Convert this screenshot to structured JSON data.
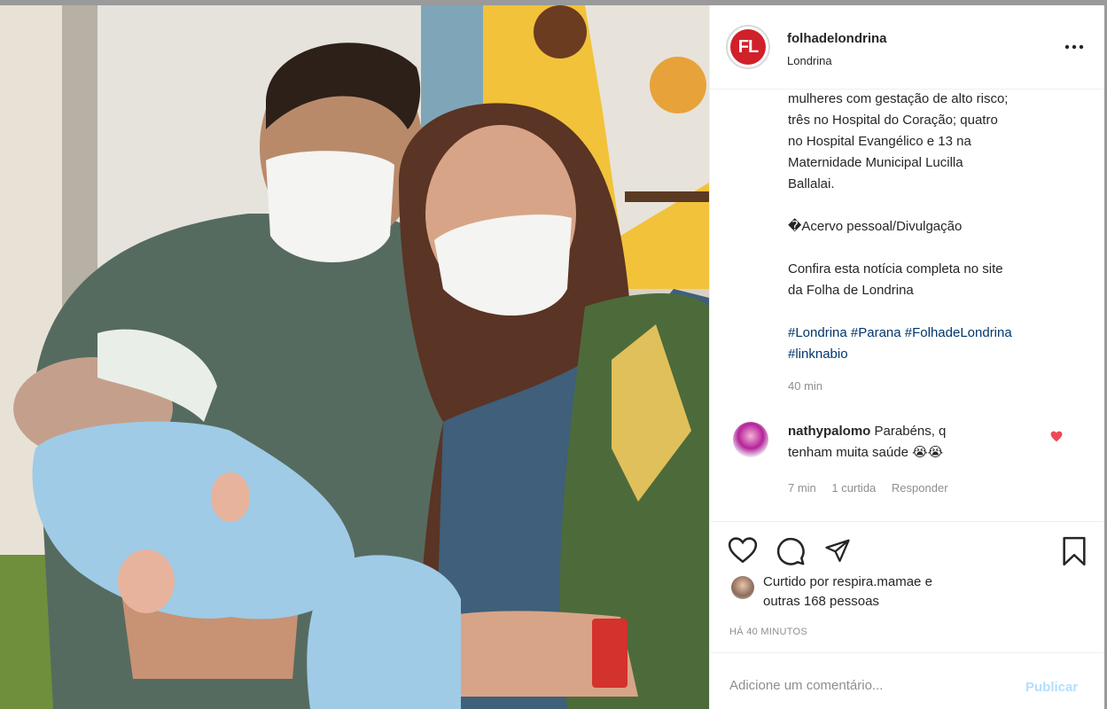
{
  "post": {
    "username": "folhadelondrina",
    "location": "Londrina",
    "logo_text": "FL",
    "more_icon": "...",
    "caption_lines_1": [
      "mulheres com gestação de alto risco;",
      "três no Hospital do Coração; quatro",
      "no Hospital Evangélico e 13 na",
      "Maternidade Municipal Lucilla",
      "Ballalai."
    ],
    "credit": "�Acervo pessoal/Divulgação",
    "caption_lines_2": [
      "Confira esta notícia completa no site",
      "da Folha de Londrina"
    ],
    "hashtags_1": "#Londrina #Parana #FolhadeLondrina",
    "hashtags_2": "#linknabio",
    "time": "40 min"
  },
  "comment": {
    "user": "nathypalomo",
    "text_1": "Parabéns, q",
    "text_2": "tenham muita saúde 😭😭",
    "time": "7 min",
    "likes": "1 curtida",
    "reply": "Responder"
  },
  "likes": {
    "line_1": "Curtido por respira.mamae e",
    "line_2": "outras 168 pessoas"
  },
  "posted_ago": "HÁ 40 MINUTOS",
  "comment_box": {
    "placeholder": "Adicione um comentário...",
    "publish": "Publicar"
  },
  "colors": {
    "brand_red": "#d0202a",
    "hashtag_blue": "#00376b",
    "heart_red": "#ed4956",
    "publish_disabled": "#b2dffc"
  },
  "icons": [
    "heart-icon",
    "comment-icon",
    "share-icon",
    "bookmark-icon",
    "more-icon",
    "liked-heart-icon"
  ]
}
